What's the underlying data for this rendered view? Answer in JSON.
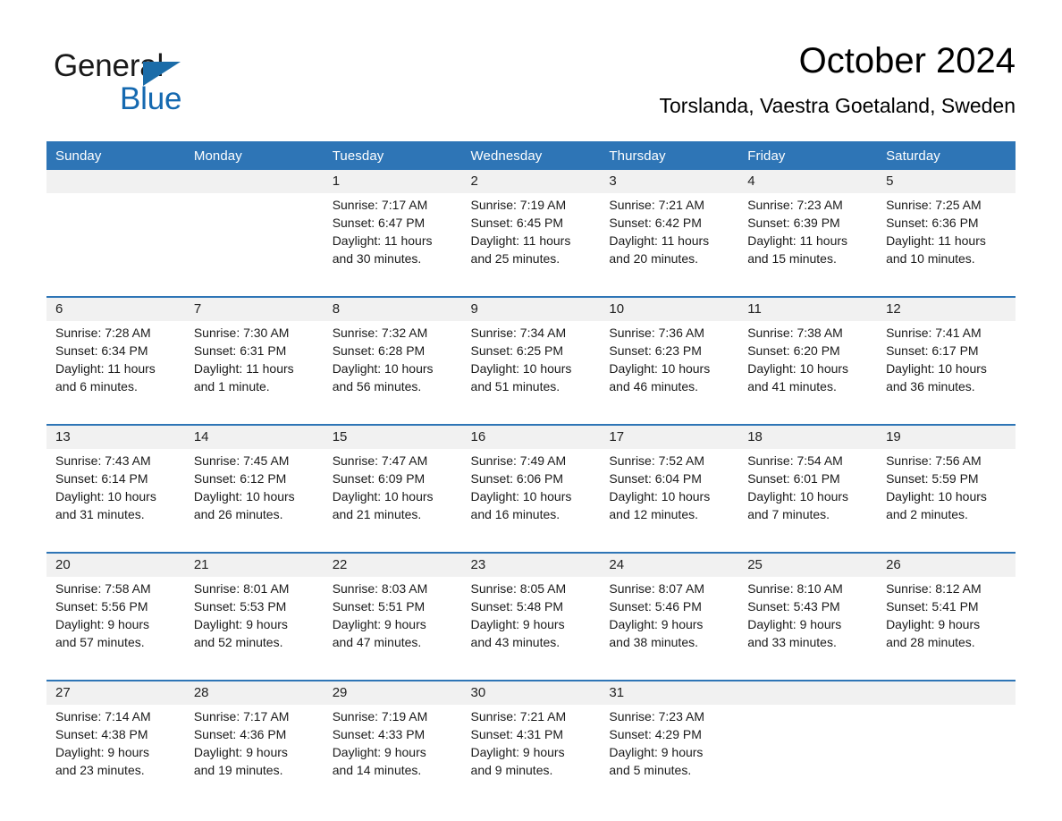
{
  "brand": {
    "name_part1": "General",
    "name_part2": "Blue",
    "accent_color": "#1569b0",
    "logo_icon": "triangle-flag-icon"
  },
  "header": {
    "title": "October 2024",
    "location": "Torslanda, Vaestra Goetaland, Sweden"
  },
  "calendar": {
    "header_bg": "#2e75b6",
    "daynum_bg": "#f1f1f1",
    "weekdays": [
      "Sunday",
      "Monday",
      "Tuesday",
      "Wednesday",
      "Thursday",
      "Friday",
      "Saturday"
    ],
    "weeks": [
      [
        {
          "day": "",
          "lines": []
        },
        {
          "day": "",
          "lines": []
        },
        {
          "day": "1",
          "lines": [
            "Sunrise: 7:17 AM",
            "Sunset: 6:47 PM",
            "Daylight: 11 hours",
            "and 30 minutes."
          ]
        },
        {
          "day": "2",
          "lines": [
            "Sunrise: 7:19 AM",
            "Sunset: 6:45 PM",
            "Daylight: 11 hours",
            "and 25 minutes."
          ]
        },
        {
          "day": "3",
          "lines": [
            "Sunrise: 7:21 AM",
            "Sunset: 6:42 PM",
            "Daylight: 11 hours",
            "and 20 minutes."
          ]
        },
        {
          "day": "4",
          "lines": [
            "Sunrise: 7:23 AM",
            "Sunset: 6:39 PM",
            "Daylight: 11 hours",
            "and 15 minutes."
          ]
        },
        {
          "day": "5",
          "lines": [
            "Sunrise: 7:25 AM",
            "Sunset: 6:36 PM",
            "Daylight: 11 hours",
            "and 10 minutes."
          ]
        }
      ],
      [
        {
          "day": "6",
          "lines": [
            "Sunrise: 7:28 AM",
            "Sunset: 6:34 PM",
            "Daylight: 11 hours",
            "and 6 minutes."
          ]
        },
        {
          "day": "7",
          "lines": [
            "Sunrise: 7:30 AM",
            "Sunset: 6:31 PM",
            "Daylight: 11 hours",
            "and 1 minute."
          ]
        },
        {
          "day": "8",
          "lines": [
            "Sunrise: 7:32 AM",
            "Sunset: 6:28 PM",
            "Daylight: 10 hours",
            "and 56 minutes."
          ]
        },
        {
          "day": "9",
          "lines": [
            "Sunrise: 7:34 AM",
            "Sunset: 6:25 PM",
            "Daylight: 10 hours",
            "and 51 minutes."
          ]
        },
        {
          "day": "10",
          "lines": [
            "Sunrise: 7:36 AM",
            "Sunset: 6:23 PM",
            "Daylight: 10 hours",
            "and 46 minutes."
          ]
        },
        {
          "day": "11",
          "lines": [
            "Sunrise: 7:38 AM",
            "Sunset: 6:20 PM",
            "Daylight: 10 hours",
            "and 41 minutes."
          ]
        },
        {
          "day": "12",
          "lines": [
            "Sunrise: 7:41 AM",
            "Sunset: 6:17 PM",
            "Daylight: 10 hours",
            "and 36 minutes."
          ]
        }
      ],
      [
        {
          "day": "13",
          "lines": [
            "Sunrise: 7:43 AM",
            "Sunset: 6:14 PM",
            "Daylight: 10 hours",
            "and 31 minutes."
          ]
        },
        {
          "day": "14",
          "lines": [
            "Sunrise: 7:45 AM",
            "Sunset: 6:12 PM",
            "Daylight: 10 hours",
            "and 26 minutes."
          ]
        },
        {
          "day": "15",
          "lines": [
            "Sunrise: 7:47 AM",
            "Sunset: 6:09 PM",
            "Daylight: 10 hours",
            "and 21 minutes."
          ]
        },
        {
          "day": "16",
          "lines": [
            "Sunrise: 7:49 AM",
            "Sunset: 6:06 PM",
            "Daylight: 10 hours",
            "and 16 minutes."
          ]
        },
        {
          "day": "17",
          "lines": [
            "Sunrise: 7:52 AM",
            "Sunset: 6:04 PM",
            "Daylight: 10 hours",
            "and 12 minutes."
          ]
        },
        {
          "day": "18",
          "lines": [
            "Sunrise: 7:54 AM",
            "Sunset: 6:01 PM",
            "Daylight: 10 hours",
            "and 7 minutes."
          ]
        },
        {
          "day": "19",
          "lines": [
            "Sunrise: 7:56 AM",
            "Sunset: 5:59 PM",
            "Daylight: 10 hours",
            "and 2 minutes."
          ]
        }
      ],
      [
        {
          "day": "20",
          "lines": [
            "Sunrise: 7:58 AM",
            "Sunset: 5:56 PM",
            "Daylight: 9 hours",
            "and 57 minutes."
          ]
        },
        {
          "day": "21",
          "lines": [
            "Sunrise: 8:01 AM",
            "Sunset: 5:53 PM",
            "Daylight: 9 hours",
            "and 52 minutes."
          ]
        },
        {
          "day": "22",
          "lines": [
            "Sunrise: 8:03 AM",
            "Sunset: 5:51 PM",
            "Daylight: 9 hours",
            "and 47 minutes."
          ]
        },
        {
          "day": "23",
          "lines": [
            "Sunrise: 8:05 AM",
            "Sunset: 5:48 PM",
            "Daylight: 9 hours",
            "and 43 minutes."
          ]
        },
        {
          "day": "24",
          "lines": [
            "Sunrise: 8:07 AM",
            "Sunset: 5:46 PM",
            "Daylight: 9 hours",
            "and 38 minutes."
          ]
        },
        {
          "day": "25",
          "lines": [
            "Sunrise: 8:10 AM",
            "Sunset: 5:43 PM",
            "Daylight: 9 hours",
            "and 33 minutes."
          ]
        },
        {
          "day": "26",
          "lines": [
            "Sunrise: 8:12 AM",
            "Sunset: 5:41 PM",
            "Daylight: 9 hours",
            "and 28 minutes."
          ]
        }
      ],
      [
        {
          "day": "27",
          "lines": [
            "Sunrise: 7:14 AM",
            "Sunset: 4:38 PM",
            "Daylight: 9 hours",
            "and 23 minutes."
          ]
        },
        {
          "day": "28",
          "lines": [
            "Sunrise: 7:17 AM",
            "Sunset: 4:36 PM",
            "Daylight: 9 hours",
            "and 19 minutes."
          ]
        },
        {
          "day": "29",
          "lines": [
            "Sunrise: 7:19 AM",
            "Sunset: 4:33 PM",
            "Daylight: 9 hours",
            "and 14 minutes."
          ]
        },
        {
          "day": "30",
          "lines": [
            "Sunrise: 7:21 AM",
            "Sunset: 4:31 PM",
            "Daylight: 9 hours",
            "and 9 minutes."
          ]
        },
        {
          "day": "31",
          "lines": [
            "Sunrise: 7:23 AM",
            "Sunset: 4:29 PM",
            "Daylight: 9 hours",
            "and 5 minutes."
          ]
        },
        {
          "day": "",
          "lines": []
        },
        {
          "day": "",
          "lines": []
        }
      ]
    ]
  }
}
